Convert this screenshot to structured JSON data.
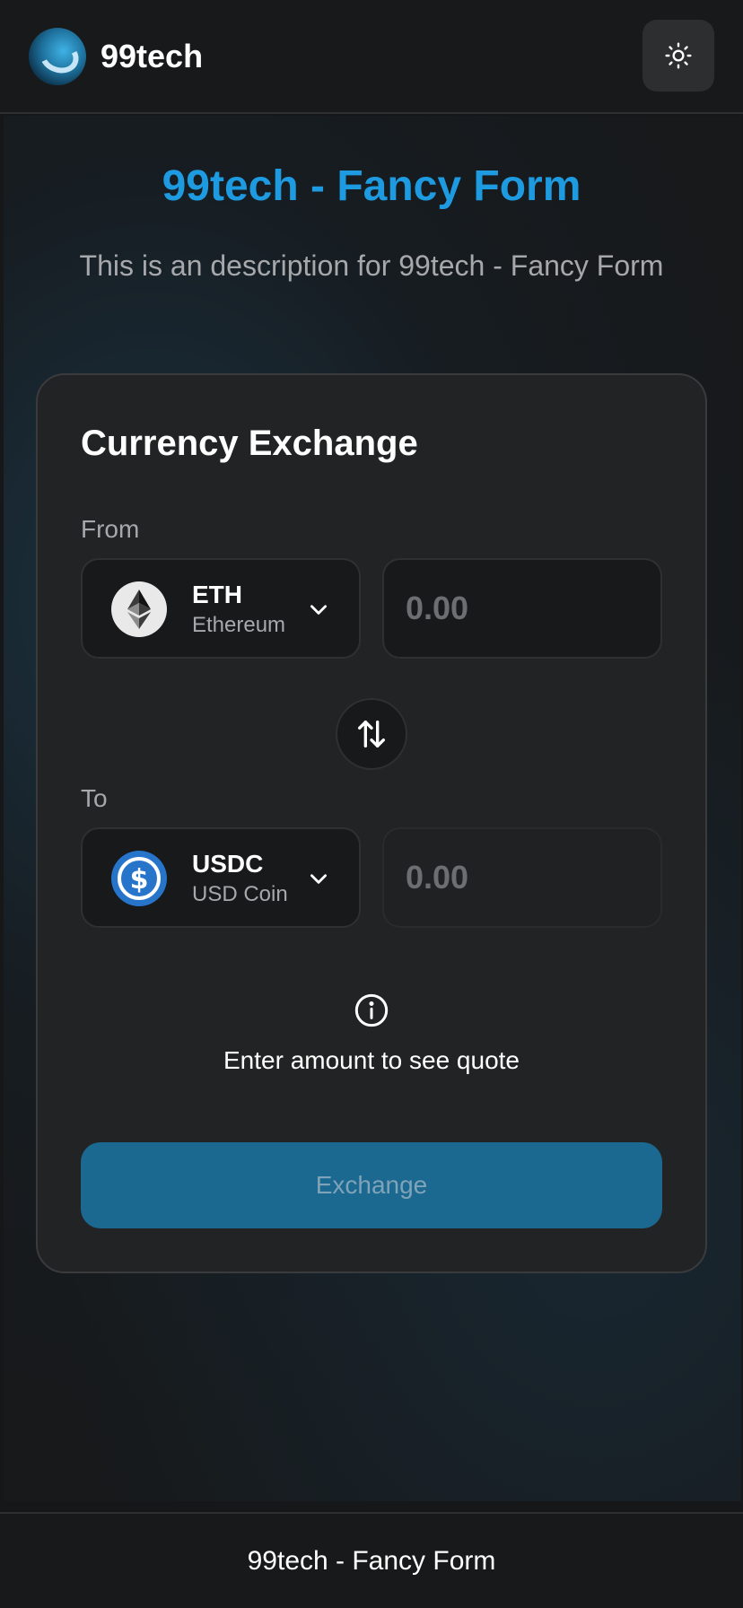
{
  "header": {
    "brand": "99tech",
    "theme_toggle_icon": "sun-icon"
  },
  "hero": {
    "title": "99tech - Fancy Form",
    "description": "This is an description for 99tech - Fancy Form"
  },
  "card": {
    "title": "Currency Exchange",
    "from": {
      "label": "From",
      "token_symbol": "ETH",
      "token_name": "Ethereum",
      "token_icon": "ethereum-icon",
      "amount_value": "",
      "amount_placeholder": "0.00"
    },
    "swap_icon": "swap-vertical-icon",
    "to": {
      "label": "To",
      "token_symbol": "USDC",
      "token_name": "USD Coin",
      "token_icon": "usdc-icon",
      "amount_value": "",
      "amount_placeholder": "0.00"
    },
    "quote": {
      "icon": "info-icon",
      "text": "Enter amount to see quote"
    },
    "exchange_label": "Exchange"
  },
  "footer": {
    "text": "99tech - Fancy Form"
  },
  "colors": {
    "accent": "#1e9be0",
    "button": "#1b6890",
    "background": "#161718",
    "card": "#222324",
    "usdc": "#2775ca"
  }
}
